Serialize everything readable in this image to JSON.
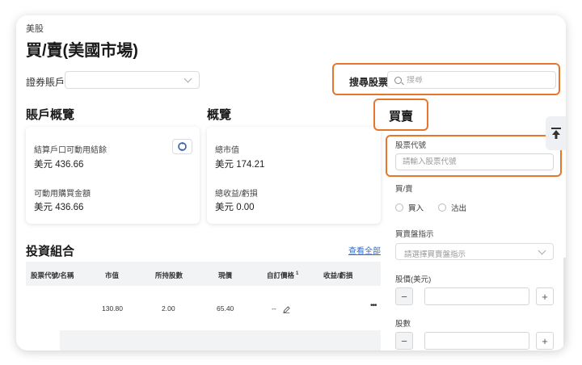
{
  "breadcrumb": "美股",
  "title": "買/賣(美國市場)",
  "account": {
    "label": "證券賬戶",
    "value": ""
  },
  "search": {
    "label": "搜尋股票",
    "placeholder": "搜尋"
  },
  "account_overview": {
    "heading": "賬戶概覽",
    "settled_label": "結算戶口可動用結餘",
    "settled_value": "美元 436.66",
    "buying_power_label": "可動用購買金額",
    "buying_power_value": "美元 436.66"
  },
  "overview": {
    "heading": "概覽",
    "market_value_label": "總市值",
    "market_value": "美元 174.21",
    "pnl_label": "總收益/虧損",
    "pnl_value": "美元 0.00"
  },
  "portfolio": {
    "heading": "投資組合",
    "view_all": "查看全部",
    "columns": [
      "股票代號/名稱",
      "市值",
      "所持股數",
      "現價",
      "自訂價格",
      "收益/虧損"
    ],
    "custom_price_sup": "1",
    "rows": [
      {
        "symbol": "",
        "market_value": "130.80",
        "shares": "2.00",
        "price": "65.40",
        "custom_price": "--",
        "pnl": ""
      }
    ],
    "more_icon": "more-dots-icon"
  },
  "trade": {
    "heading": "買賣",
    "symbol_label": "股票代號",
    "symbol_placeholder": "請輸入股票代號",
    "side_label": "買/賣",
    "buy_label": "買入",
    "sell_label": "沽出",
    "order_type_label": "買賣盤指示",
    "order_type_placeholder": "請選擇買賣盤指示",
    "price_label": "股價(美元)",
    "qty_label": "股數",
    "minus": "−",
    "plus": "+"
  },
  "colors": {
    "highlight": "#e8762a",
    "link": "#2f6fd6",
    "header_bg": "#f2f3f5"
  }
}
